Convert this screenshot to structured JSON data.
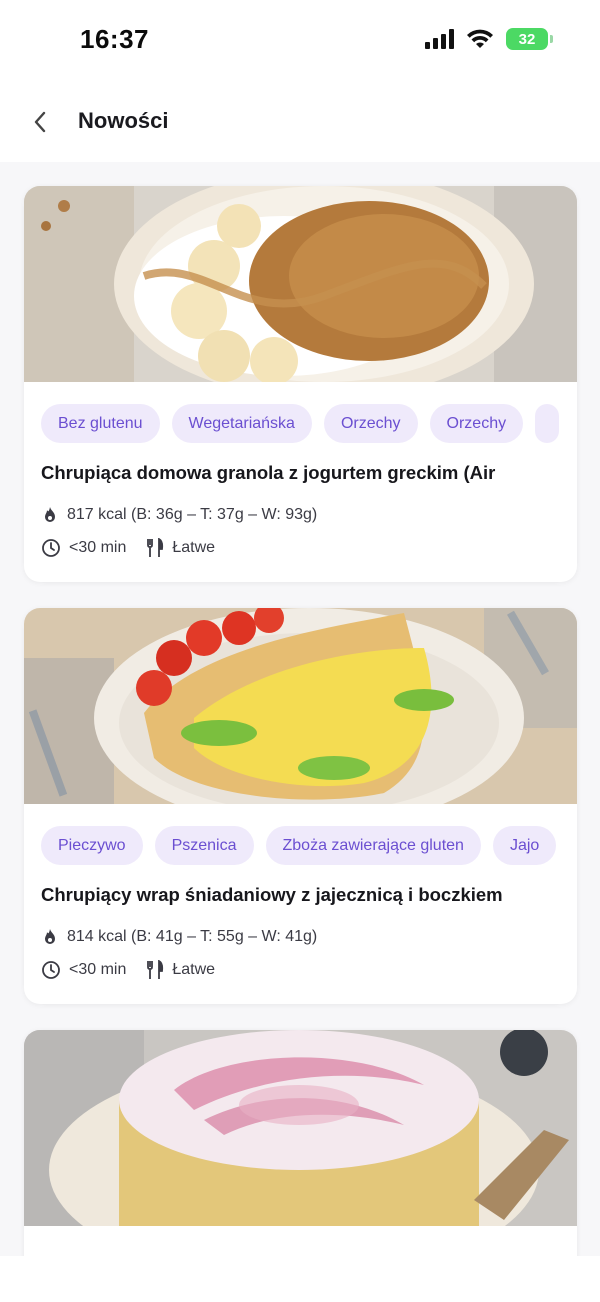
{
  "status_bar": {
    "time": "16:37",
    "battery": "32"
  },
  "header": {
    "title": "Nowości"
  },
  "colors": {
    "accent": "#6b4fd1",
    "tag_bg": "#efeafb",
    "battery": "#4cd964"
  },
  "recipes": [
    {
      "tags": [
        "Bez glutenu",
        "Wegetariańska",
        "Orzechy",
        "Orzechy",
        ""
      ],
      "title": "Chrupiąca domowa granola z jogurtem greckim (Air",
      "nutrition": "817 kcal (B: 36g – T: 37g – W: 93g)",
      "time": "<30 min",
      "difficulty": "Łatwe",
      "image": "granola-yogurt-banana-photo"
    },
    {
      "tags": [
        "Pieczywo",
        "Pszenica",
        "Zboża zawierające gluten",
        "Jajo"
      ],
      "title": "Chrupiący wrap śniadaniowy z jajecznicą i boczkiem",
      "nutrition": "814 kcal (B: 41g – T: 55g – W: 41g)",
      "time": "<30 min",
      "difficulty": "Łatwe",
      "image": "breakfast-wrap-photo"
    },
    {
      "image": "poppy-seed-cheesecake-photo"
    }
  ]
}
